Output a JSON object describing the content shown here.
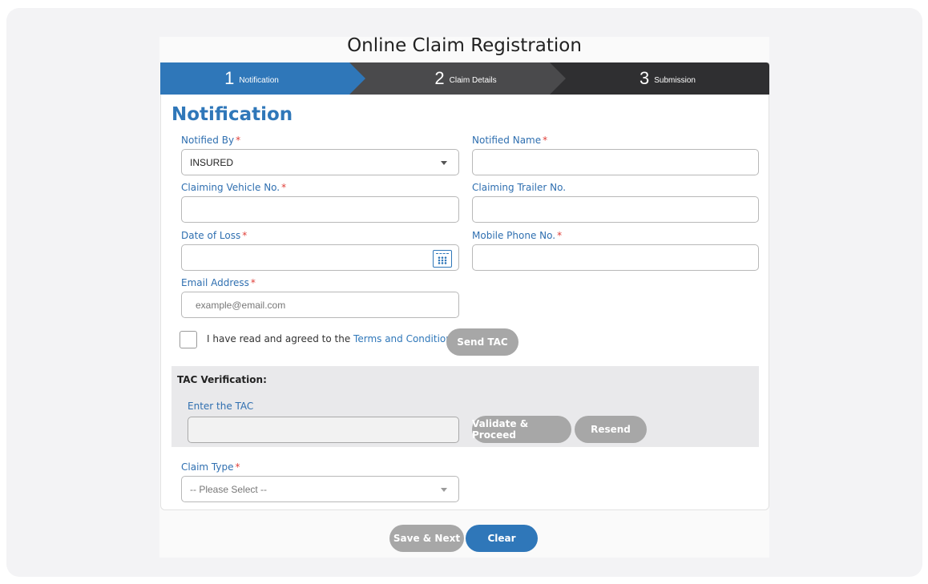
{
  "page": {
    "title": "Online Claim Registration"
  },
  "stepper": {
    "steps": [
      {
        "num": "1",
        "label": "Notification"
      },
      {
        "num": "2",
        "label": "Claim Details"
      },
      {
        "num": "3",
        "label": "Submission"
      }
    ],
    "active_index": 0
  },
  "form": {
    "section_title": "Notification",
    "required_mark": "*",
    "notified_by": {
      "label": "Notified By",
      "value": "INSURED"
    },
    "notified_name": {
      "label": "Notified Name",
      "value": ""
    },
    "claiming_vehicle_no": {
      "label": "Claiming Vehicle No.",
      "value": ""
    },
    "claiming_trailer_no": {
      "label": "Claiming Trailer No.",
      "value": ""
    },
    "date_of_loss": {
      "label": "Date of Loss",
      "value": "",
      "icon": "calendar-icon"
    },
    "mobile_phone_no": {
      "label": "Mobile Phone No.",
      "value": ""
    },
    "email_address": {
      "label": "Email Address",
      "placeholder": "example@email.com"
    },
    "terms": {
      "prefix": "I have read and agreed to the ",
      "link": "Terms and Conditions",
      "suffix": ".",
      "checked": false
    },
    "send_tac_label": "Send TAC",
    "tac": {
      "title": "TAC Verification:",
      "label": "Enter the TAC",
      "value": "",
      "validate_label": "Validate & Proceed",
      "resend_label": "Resend"
    },
    "claim_type": {
      "label": "Claim Type",
      "placeholder": "-- Please Select --"
    }
  },
  "footer": {
    "save_next_label": "Save & Next",
    "clear_label": "Clear"
  },
  "colors": {
    "primary": "#2f77b9",
    "required": "#e0403a",
    "disabled_button": "#a7a7a7"
  }
}
